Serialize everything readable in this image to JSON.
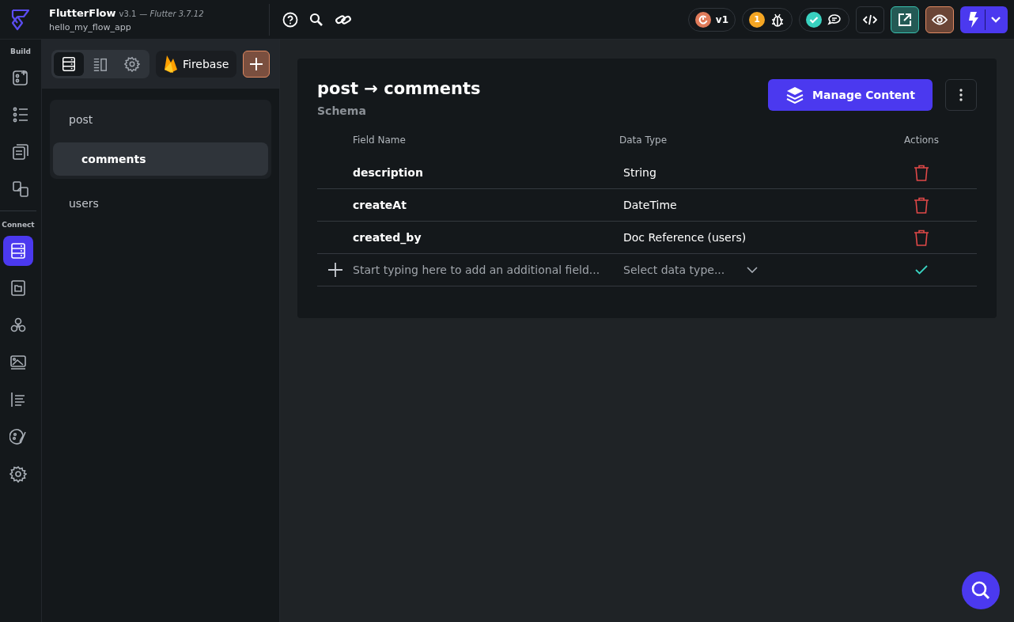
{
  "header": {
    "app_name": "FlutterFlow",
    "version": "v3.1",
    "flutter_version": "— Flutter 3.7.12",
    "project": "hello_my_flow_app"
  },
  "toolbar": {
    "version_badge": "v1",
    "issues_count": "1"
  },
  "rail": {
    "sections": [
      {
        "label": "Build",
        "items": [
          {
            "kind": "widget",
            "selected": false
          },
          {
            "kind": "tree",
            "selected": false
          },
          {
            "kind": "pages",
            "selected": false
          },
          {
            "kind": "link",
            "selected": false
          }
        ]
      },
      {
        "label": "Connect",
        "items": [
          {
            "kind": "database",
            "selected": true
          },
          {
            "kind": "media",
            "selected": false
          },
          {
            "kind": "api",
            "selected": false
          },
          {
            "kind": "image",
            "selected": false
          },
          {
            "kind": "text",
            "selected": false
          },
          {
            "kind": "theme",
            "selected": false
          },
          {
            "kind": "gear",
            "selected": false
          }
        ]
      }
    ]
  },
  "panel": {
    "tabs": [
      {
        "kind": "database",
        "selected": true
      },
      {
        "kind": "columns",
        "selected": false
      },
      {
        "kind": "gear",
        "selected": false
      }
    ],
    "provider": "Firebase",
    "collections": [
      {
        "name": "post",
        "selected": false,
        "children": [
          {
            "name": "comments",
            "selected": true
          }
        ]
      },
      {
        "name": "users",
        "selected": false
      }
    ]
  },
  "schema": {
    "title": "post → comments",
    "subtitle": "Schema",
    "manage_button": "Manage Content",
    "columns": [
      "Field Name",
      "Data Type",
      "Actions"
    ],
    "rows": [
      {
        "field": "description",
        "type": "String"
      },
      {
        "field": "createAt",
        "type": "DateTime"
      },
      {
        "field": "created_by",
        "type": "Doc Reference (users)"
      }
    ],
    "new_field": {
      "placeholder": "Start typing here to add an additional field...",
      "type_placeholder": "Select data type..."
    }
  }
}
